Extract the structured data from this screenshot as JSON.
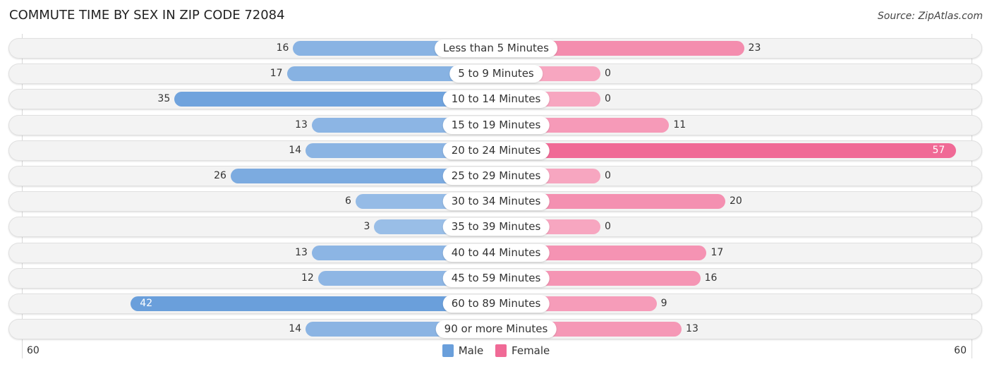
{
  "header": {
    "title": "COMMUTE TIME BY SEX IN ZIP CODE 72084",
    "source": "Source: ZipAtlas.com"
  },
  "colors": {
    "male_strong": "#6a9fdb",
    "male_light": "#9dc0e8",
    "female_strong": "#f06a96",
    "female_light": "#f7a6c0"
  },
  "chart_data": {
    "type": "bar",
    "orientation": "horizontal-diverging",
    "title": "COMMUTE TIME BY SEX IN ZIP CODE 72084",
    "categories": [
      "Less than 5 Minutes",
      "5 to 9 Minutes",
      "10 to 14 Minutes",
      "15 to 19 Minutes",
      "20 to 24 Minutes",
      "25 to 29 Minutes",
      "30 to 34 Minutes",
      "35 to 39 Minutes",
      "40 to 44 Minutes",
      "45 to 59 Minutes",
      "60 to 89 Minutes",
      "90 or more Minutes"
    ],
    "series": [
      {
        "name": "Male",
        "values": [
          16,
          17,
          35,
          13,
          14,
          26,
          6,
          3,
          13,
          12,
          42,
          14
        ]
      },
      {
        "name": "Female",
        "values": [
          23,
          0,
          0,
          11,
          57,
          0,
          20,
          0,
          17,
          16,
          9,
          13
        ]
      }
    ],
    "axis": {
      "left_max": 60,
      "right_max": 60,
      "left_label": "60",
      "right_label": "60"
    },
    "legend": {
      "position": "bottom-center",
      "entries": [
        "Male",
        "Female"
      ]
    },
    "grid": false
  }
}
